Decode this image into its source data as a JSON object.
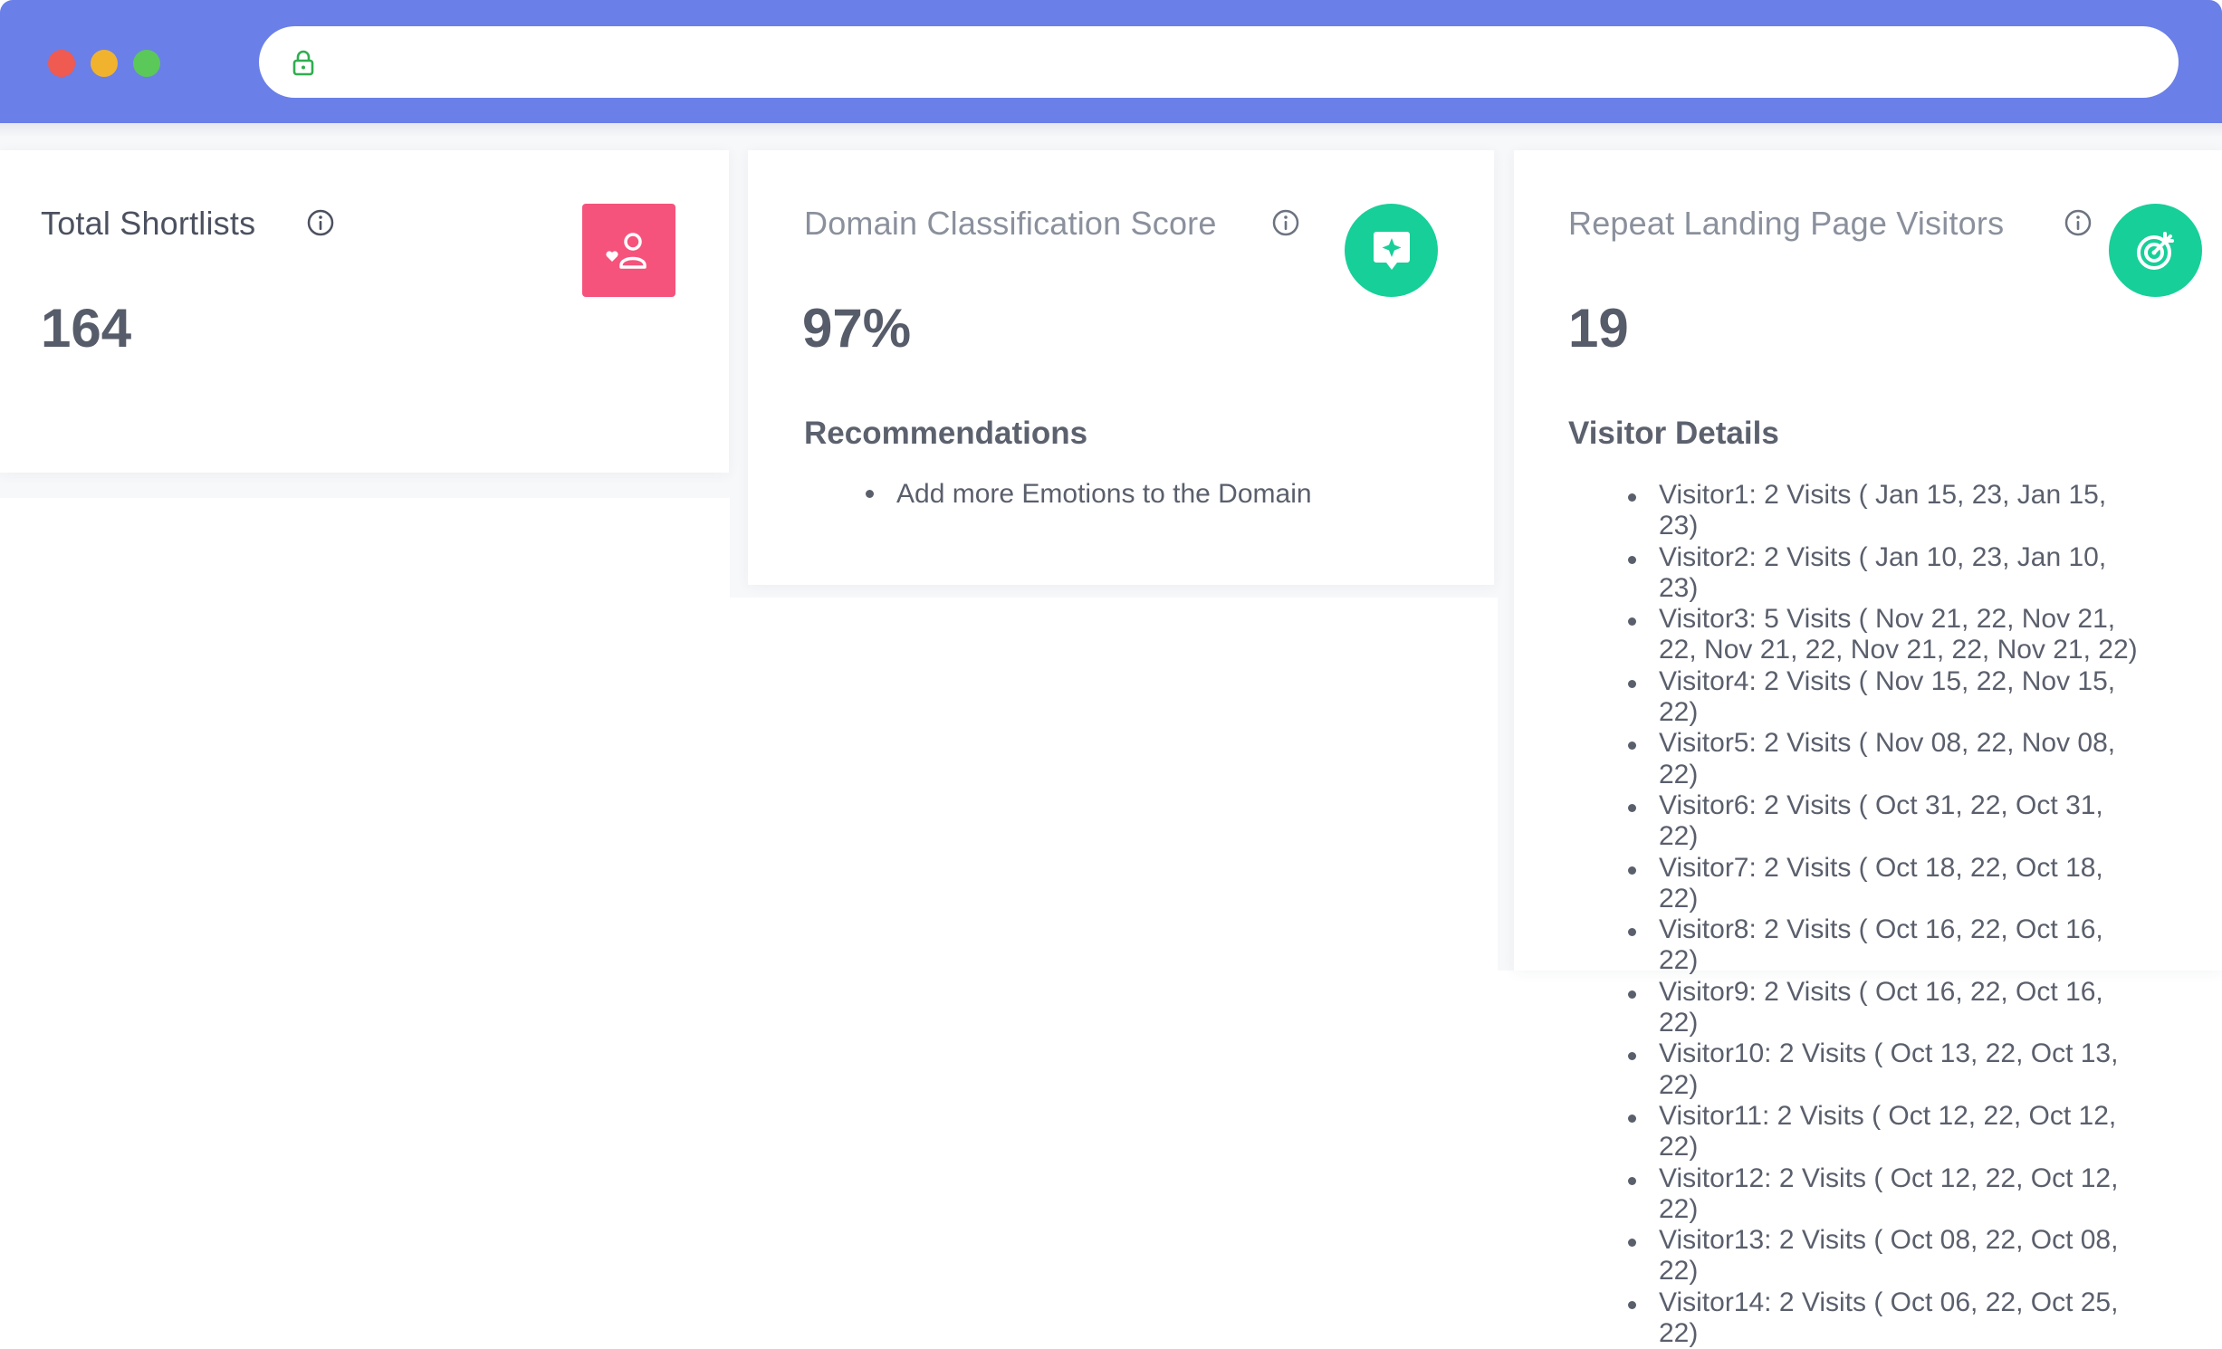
{
  "browser": {
    "dots": [
      "close",
      "minimize",
      "maximize"
    ],
    "address": "",
    "accent_color": "#6a7fe8"
  },
  "cards": {
    "shortlists": {
      "title": "Total Shortlists",
      "value": "164",
      "icon": "user-heart-icon",
      "icon_color": "#f5537c"
    },
    "domain_score": {
      "title": "Domain Classification Score",
      "value": "97%",
      "icon": "sparkle-bubble-icon",
      "icon_color": "#17cf99",
      "recommendations_title": "Recommendations",
      "recommendations": [
        "Add more Emotions to the Domain"
      ]
    },
    "repeat_visitors": {
      "title": "Repeat Landing Page Visitors",
      "value": "19",
      "icon": "target-icon",
      "icon_color": "#17cf99",
      "details_title": "Visitor Details",
      "visitors": [
        "Visitor1: 2 Visits ( Jan 15, 23, Jan 15, 23)",
        "Visitor2: 2 Visits ( Jan 10, 23, Jan 10, 23)",
        "Visitor3: 5 Visits ( Nov 21, 22, Nov 21, 22, Nov 21, 22, Nov 21, 22, Nov 21, 22)",
        "Visitor4: 2 Visits ( Nov 15, 22, Nov 15, 22)",
        "Visitor5: 2 Visits ( Nov 08, 22, Nov 08, 22)",
        "Visitor6: 2 Visits ( Oct 31, 22, Oct 31, 22)",
        "Visitor7: 2 Visits ( Oct 18, 22, Oct 18, 22)",
        "Visitor8: 2 Visits ( Oct 16, 22, Oct 16, 22)",
        "Visitor9: 2 Visits ( Oct 16, 22, Oct 16, 22)",
        "Visitor10: 2 Visits ( Oct 13, 22, Oct 13, 22)",
        "Visitor11: 2 Visits ( Oct 12, 22, Oct 12, 22)",
        "Visitor12: 2 Visits ( Oct 12, 22, Oct 12, 22)",
        "Visitor13: 2 Visits ( Oct 08, 22, Oct 08, 22)",
        "Visitor14: 2 Visits ( Oct 06, 22, Oct 25, 22)"
      ]
    }
  }
}
